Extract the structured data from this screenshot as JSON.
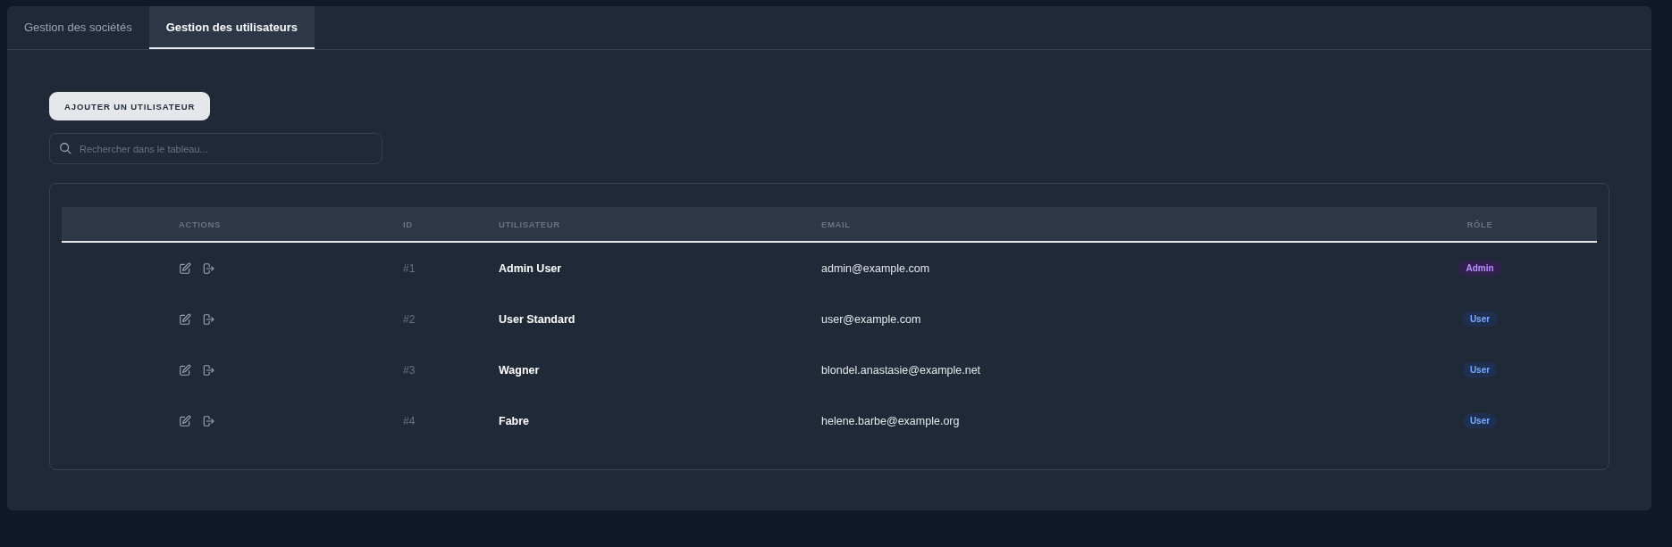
{
  "tabs": [
    {
      "label": "Gestion des sociétés",
      "selected": false
    },
    {
      "label": "Gestion des utilisateurs",
      "selected": true
    }
  ],
  "add_button": {
    "label": "AJOUTER UN UTILISATEUR"
  },
  "search": {
    "placeholder": "Rechercher dans le tableau..."
  },
  "table": {
    "columns": [
      "ACTIONS",
      "ID",
      "UTILISATEUR",
      "EMAIL",
      "RÔLE"
    ],
    "rows": [
      {
        "id": "#1",
        "user": "Admin User",
        "email": "admin@example.com",
        "role": {
          "label": "Admin",
          "color": "#32214f"
        }
      },
      {
        "id": "#2",
        "user": "User Standard",
        "email": "user@example.com",
        "role": {
          "label": "User",
          "color": "#1e2f50"
        }
      },
      {
        "id": "#3",
        "user": "Wagner",
        "email": "blondel.anastasie@example.net",
        "role": {
          "label": "User",
          "color": "#1e2f50"
        }
      },
      {
        "id": "#4",
        "user": "Fabre",
        "email": "helene.barbe@example.org",
        "role": {
          "label": "User",
          "color": "#1e2f50"
        }
      }
    ]
  }
}
